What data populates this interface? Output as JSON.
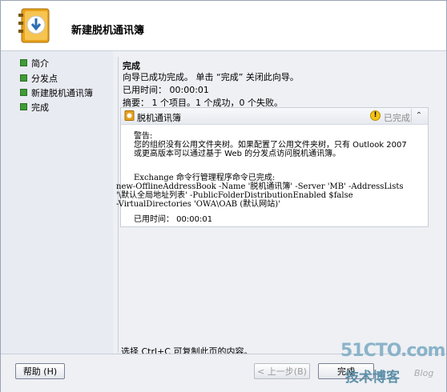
{
  "header": {
    "title": "新建脱机通讯簿",
    "icon": "address-book-wizard-icon"
  },
  "sidebar": {
    "items": [
      {
        "label": "简介"
      },
      {
        "label": "分发点"
      },
      {
        "label": "新建脱机通讯簿"
      },
      {
        "label": "完成"
      }
    ],
    "bullet_color": "#3f9c35"
  },
  "main": {
    "title": "完成",
    "message": "向导已成功完成。 单击 “完成” 关闭此向导。",
    "elapsed": "已用时间： 00:00:01",
    "summary": "摘要： 1 个项目。1 个成功，0 个失败。"
  },
  "card": {
    "title": "脱机通讯簿",
    "status": "已完成",
    "warning_label": "警告:",
    "warning_line1": "您的组织没有公用文件夹树。如果配置了公用文件夹树，只有 Outlook 2007",
    "warning_line2": "或更高版本可以通过基于 Web 的分发点访问脱机通讯簿。",
    "cmd_label": "Exchange 命令行管理程序命令已完成:",
    "cmd_line1": "new-OfflineAddressBook -Name '脱机通讯簿' -Server 'MB' -AddressLists",
    "cmd_line2": "'\\默认全局地址列表' -PublicFolderDistributionEnabled $false",
    "cmd_line3": "-VirtualDirectories 'OWA\\OAB (默认网站)'",
    "elapsed": "已用时间： 00:00:01"
  },
  "hint": "选择 Ctrl+C 可复制此页的内容。",
  "footer": {
    "help": "帮助 (H)",
    "back": "< 上一步(B)",
    "finish": "完成"
  },
  "watermark": {
    "main": "51CTO.com",
    "sub": "技术博客",
    "blog": "Blog"
  }
}
